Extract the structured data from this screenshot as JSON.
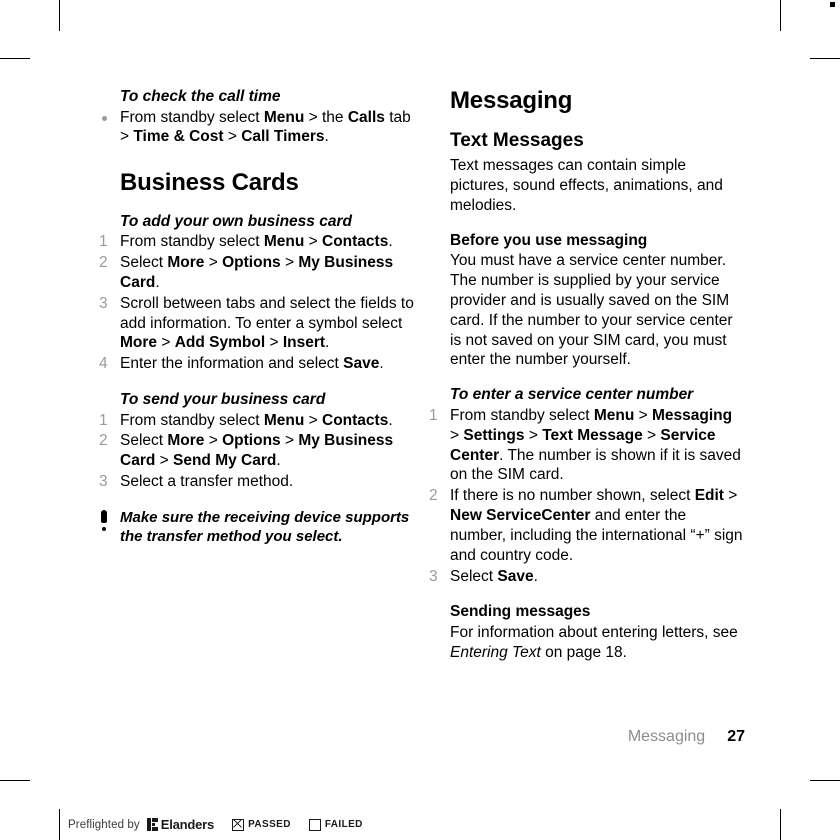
{
  "document": {
    "footer_chapter": "Messaging",
    "footer_page_number": "27"
  },
  "left_column": {
    "task1_heading": "To check the call time",
    "task1_bullet": "From standby select Menu > the Calls tab > Time & Cost > Call Timers.",
    "section_heading": "Business Cards",
    "task2_heading": "To add your own business card",
    "task2_steps": [
      {
        "num": "1",
        "text": "From standby select Menu > Contacts."
      },
      {
        "num": "2",
        "text": "Select More > Options > My Business Card."
      },
      {
        "num": "3",
        "text": "Scroll between tabs and select the fields to add information. To enter a symbol select More > Add Symbol > Insert."
      },
      {
        "num": "4",
        "text": "Enter the information and select Save."
      }
    ],
    "task3_heading": "To send your business card",
    "task3_steps": [
      {
        "num": "1",
        "text": "From standby select Menu > Contacts."
      },
      {
        "num": "2",
        "text": "Select More > Options > My Business Card > Send My Card."
      },
      {
        "num": "3",
        "text": "Select a transfer method."
      }
    ],
    "note_text": "Make sure the receiving device supports the transfer method you select."
  },
  "right_column": {
    "chapter_title": "Messaging",
    "section_heading": "Text Messages",
    "section_intro": "Text messages can contain simple pictures, sound effects, animations, and melodies.",
    "subheading_before": "Before you use messaging",
    "before_text": "You must have a service center number. The number is supplied by your service provider and is usually saved on the SIM card. If the number to your service center is not saved on your SIM card, you must enter the number yourself.",
    "task_heading": "To enter a service center number",
    "task_steps": [
      {
        "num": "1",
        "text": "From standby select Menu > Messaging > Settings > Text Message > Service Center. The number is shown if it is saved on the SIM card."
      },
      {
        "num": "2",
        "text": "If there is no number shown, select Edit > New ServiceCenter and enter the number, including the international “+” sign and country code."
      },
      {
        "num": "3",
        "text": "Select Save."
      }
    ],
    "subheading_sending": "Sending messages",
    "sending_text": "For information about entering letters, see Entering Text on page 18."
  },
  "preflight": {
    "label": "Preflighted by",
    "brand": "Elanders",
    "passed_label": "PASSED",
    "failed_label": "FAILED",
    "passed_checked": true,
    "failed_checked": false
  },
  "colors": {
    "list_number_gray": "#9a9a9a",
    "footer_gray": "#8d8d8d",
    "text_black": "#000000"
  }
}
